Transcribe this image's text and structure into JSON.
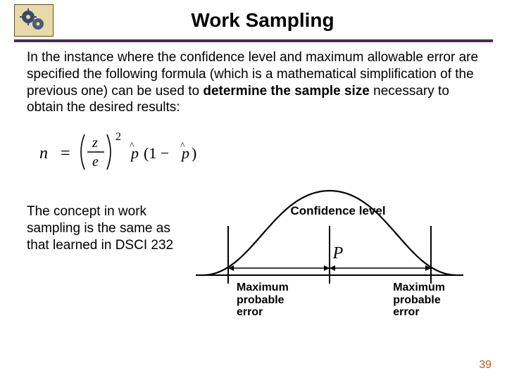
{
  "title": "Work Sampling",
  "intro_part1": "In the instance where the confidence level and maximum allowable error are specified the following formula (which is a mathematical simplification of the previous one) can be used to ",
  "intro_bold": "determine the sample size",
  "intro_part2": " necessary to obtain the desired results:",
  "formula": {
    "lhs": "n",
    "eq": "=",
    "z": "z",
    "e": "e",
    "exp": "2",
    "p1": "p̂",
    "oneminus": "(1 − p̂)"
  },
  "concept": "The concept in work sampling is the same as that learned in DSCI 232",
  "diagram": {
    "confidence": "Confidence level",
    "p": "P",
    "mpe": "Maximum probable error"
  },
  "slide_number": "39"
}
